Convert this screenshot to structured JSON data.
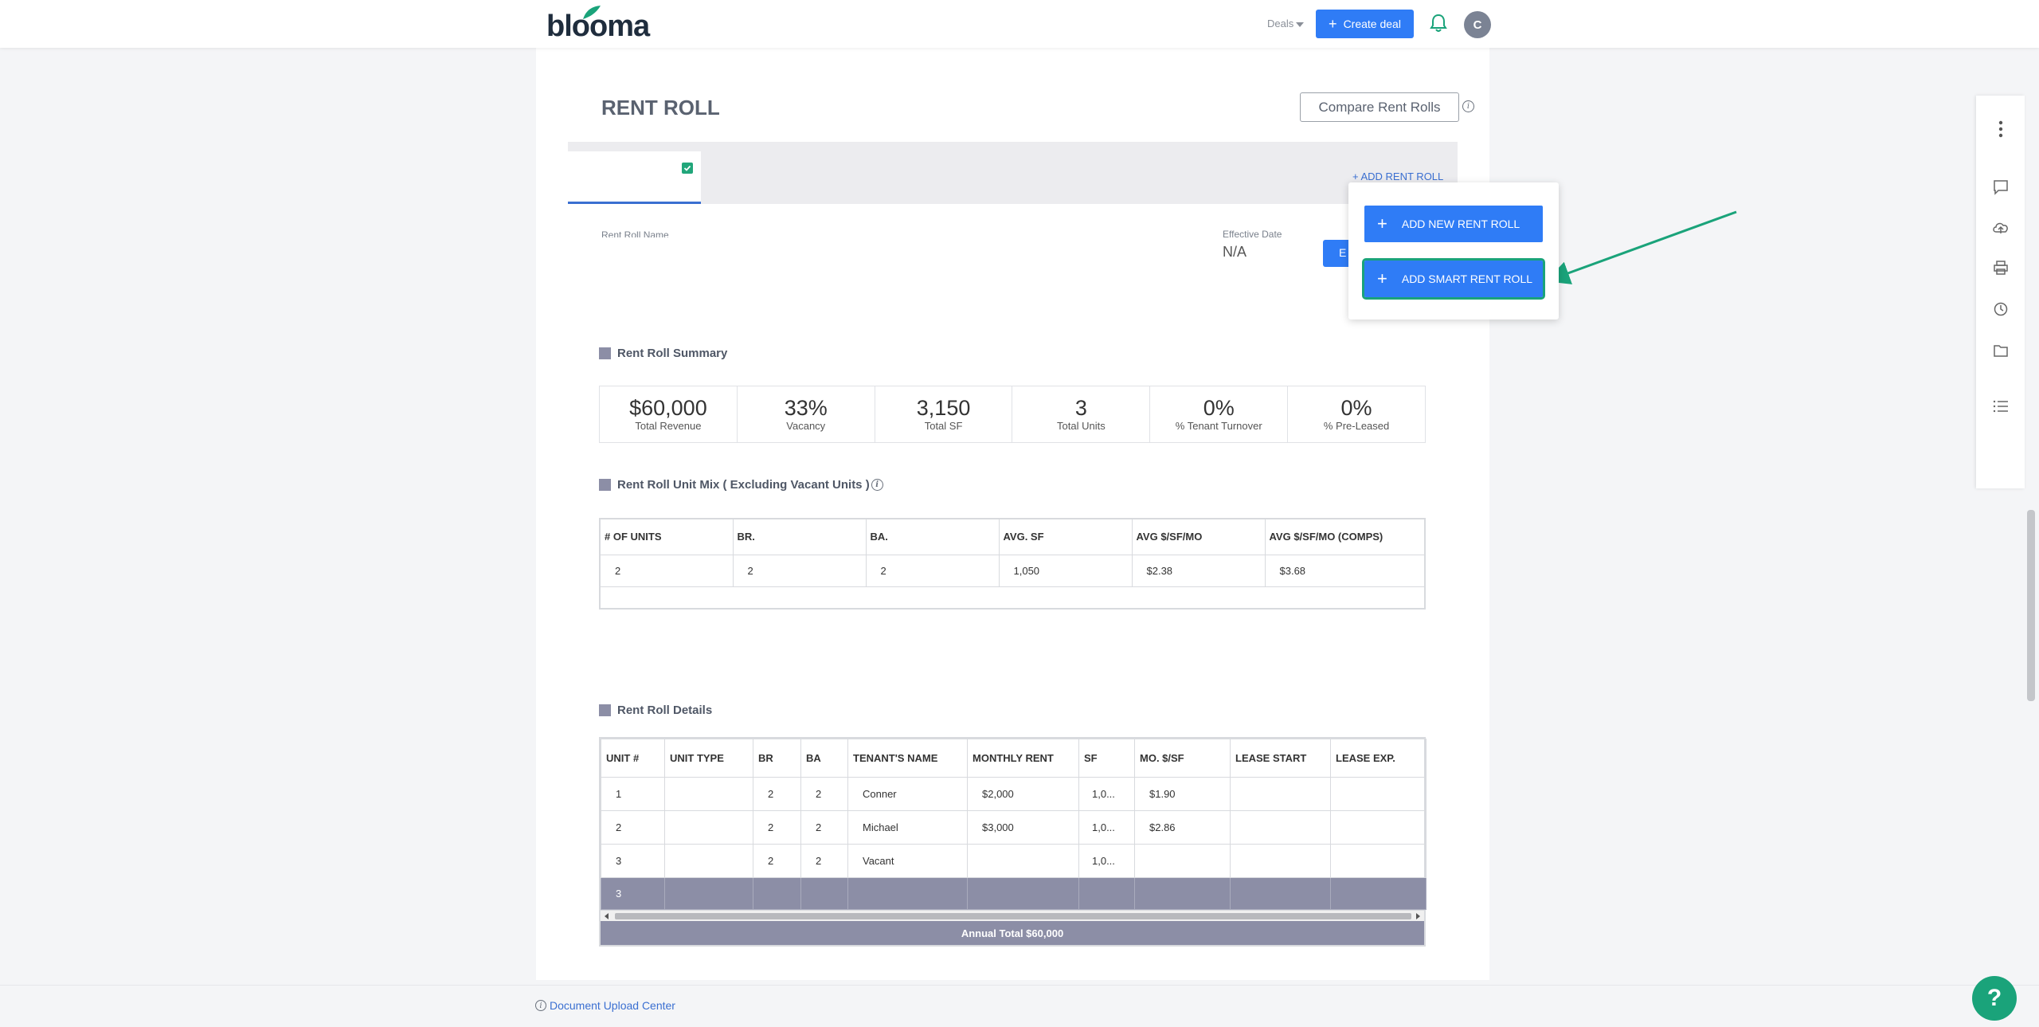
{
  "nav": {
    "logo": "blooma",
    "deals_label": "Deals",
    "create_label": "Create deal",
    "avatar_initial": "C"
  },
  "page": {
    "title": "RENT ROLL",
    "compare_label": "Compare Rent Rolls",
    "add_rent_roll_link": "+ ADD RENT ROLL",
    "rent_roll_name_label": "Rent Roll Name",
    "effective_date_label": "Effective Date",
    "effective_date_value": "N/A",
    "edit_btn_partial": "E"
  },
  "dropdown": {
    "add_new": "ADD NEW RENT ROLL",
    "add_smart": "ADD SMART RENT ROLL"
  },
  "summary": {
    "title": "Rent Roll Summary",
    "cells": [
      {
        "value": "$60,000",
        "label": "Total Revenue"
      },
      {
        "value": "33%",
        "label": "Vacancy"
      },
      {
        "value": "3,150",
        "label": "Total SF"
      },
      {
        "value": "3",
        "label": "Total Units"
      },
      {
        "value": "0%",
        "label": "% Tenant Turnover"
      },
      {
        "value": "0%",
        "label": "% Pre-Leased"
      }
    ]
  },
  "unit_mix": {
    "title": "Rent Roll Unit Mix ( Excluding Vacant Units )",
    "headers": [
      "# OF UNITS",
      "BR.",
      "BA.",
      "AVG. SF",
      "AVG $/SF/MO",
      "AVG $/SF/MO (COMPS)"
    ],
    "rows": [
      [
        "2",
        "2",
        "2",
        "1,050",
        "$2.38",
        "$3.68"
      ]
    ]
  },
  "details": {
    "title": "Rent Roll Details",
    "headers": [
      "UNIT #",
      "UNIT TYPE",
      "BR",
      "BA",
      "TENANT'S NAME",
      "MONTHLY RENT",
      "SF",
      "MO. $/SF",
      "LEASE START",
      "LEASE EXP."
    ],
    "rows": [
      [
        "1",
        "",
        "2",
        "2",
        "Conner",
        "$2,000",
        "1,0...",
        "$1.90",
        "",
        ""
      ],
      [
        "2",
        "",
        "2",
        "2",
        "Michael",
        "$3,000",
        "1,0...",
        "$2.86",
        "",
        ""
      ],
      [
        "3",
        "",
        "2",
        "2",
        "Vacant",
        "",
        "1,0...",
        "",
        "",
        ""
      ]
    ],
    "total_row_count": "3",
    "annual_total": "Annual Total $60,000"
  },
  "footer": {
    "doc_upload": "Document Upload Center",
    "help": "?"
  },
  "colors": {
    "primary": "#2f7cf6",
    "accent_green": "#1aa37a",
    "section_square": "#8c8ea6"
  }
}
